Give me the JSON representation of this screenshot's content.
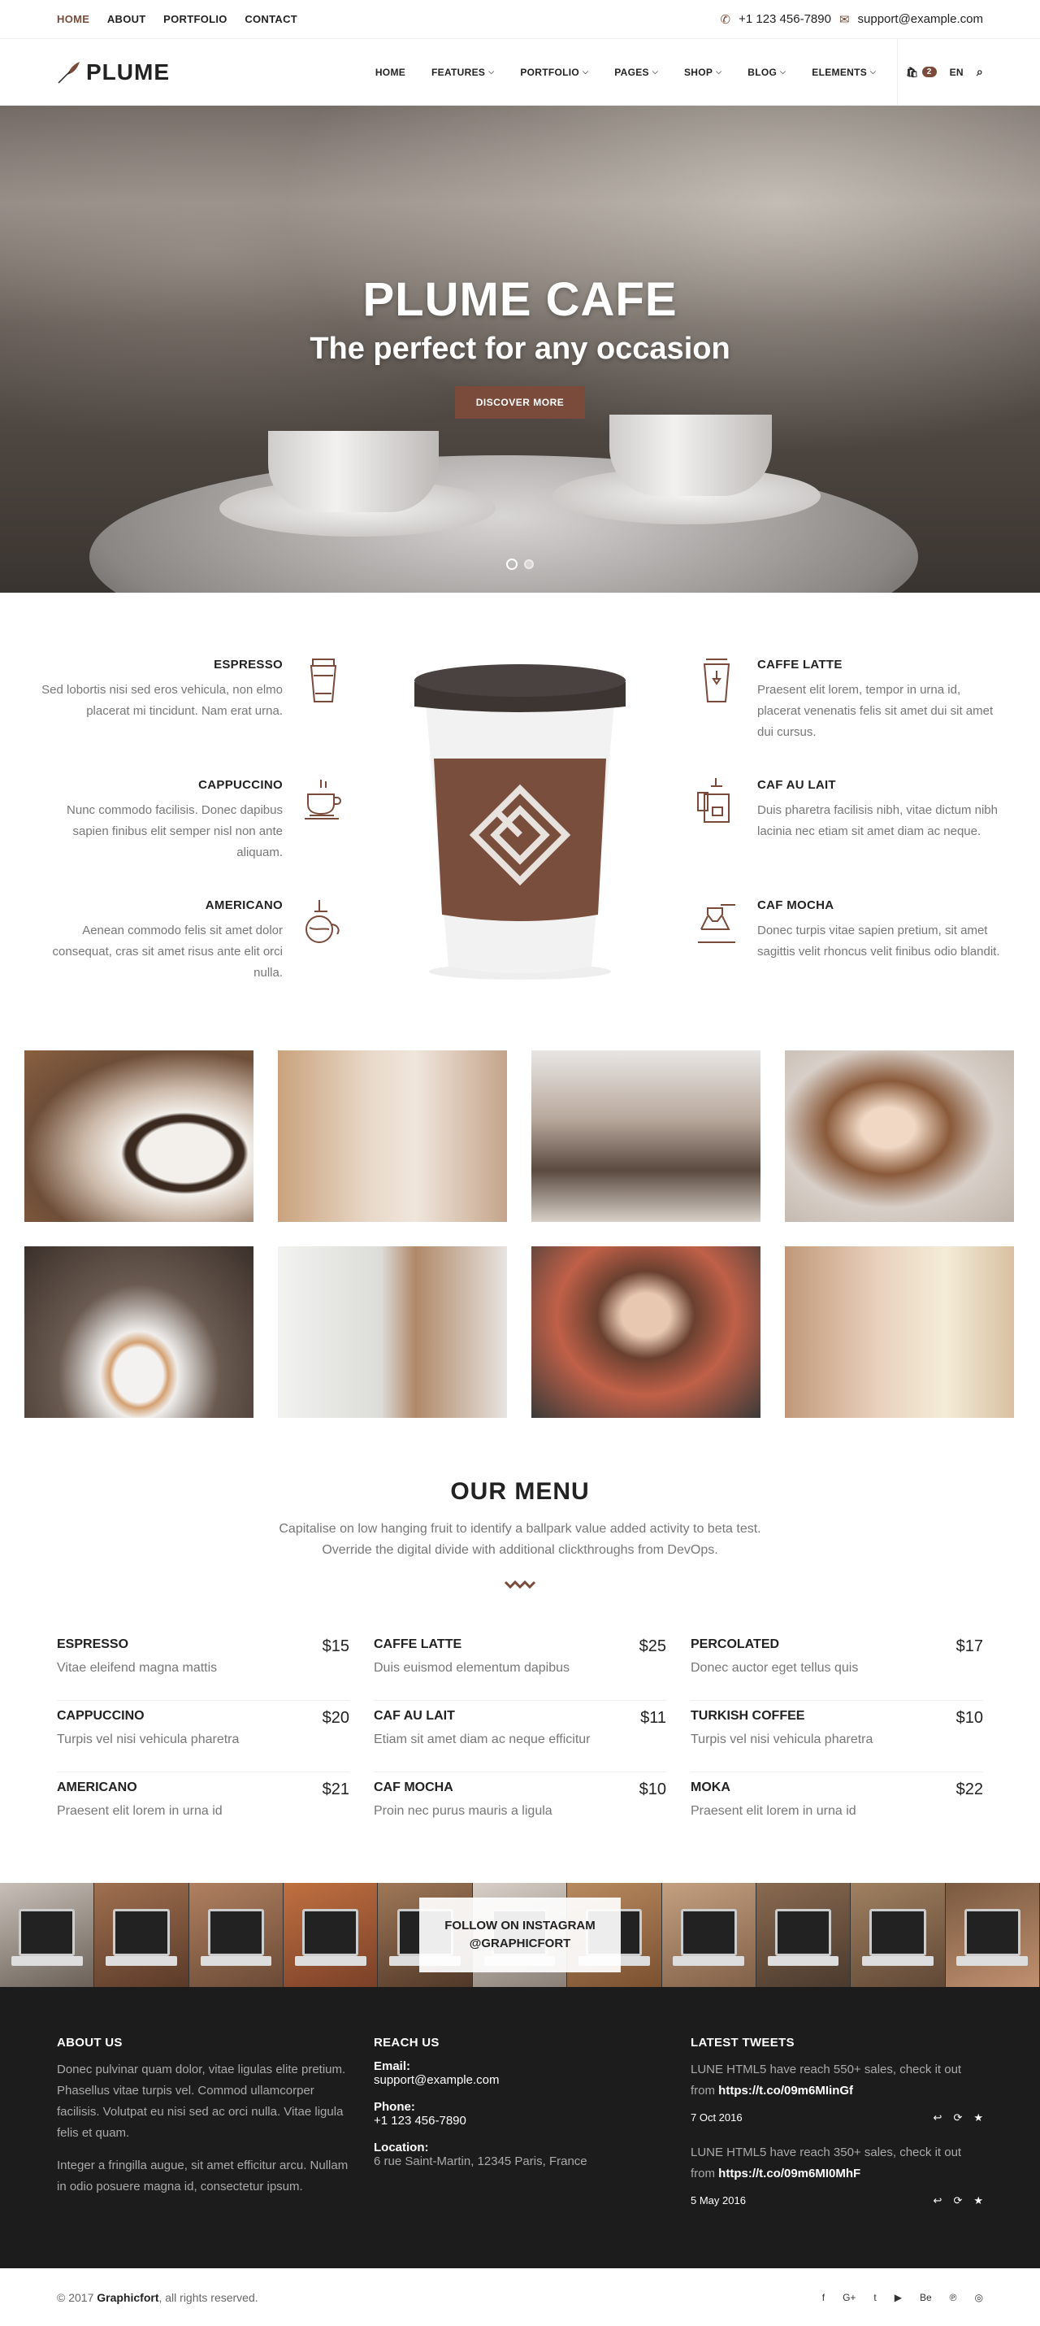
{
  "topbar": {
    "links": [
      "HOME",
      "ABOUT",
      "PORTFOLIO",
      "CONTACT"
    ],
    "phone": "+1 123 456-7890",
    "email": "support@example.com"
  },
  "header": {
    "logo": "PLUME",
    "nav": [
      "HOME",
      "FEATURES",
      "PORTFOLIO",
      "PAGES",
      "SHOP",
      "BLOG",
      "ELEMENTS"
    ],
    "cart_count": "2",
    "lang": "EN"
  },
  "hero": {
    "title": "PLUME CAFE",
    "subtitle": "The perfect for any occasion",
    "button": "DISCOVER MORE"
  },
  "features": {
    "left": [
      {
        "title": "ESPRESSO",
        "text": "Sed lobortis nisi sed eros vehicula, non elmo placerat mi tincidunt. Nam erat urna."
      },
      {
        "title": "CAPPUCCINO",
        "text": "Nunc commodo facilisis. Donec dapibus sapien finibus elit semper nisl non ante aliquam."
      },
      {
        "title": "AMERICANO",
        "text": "Aenean commodo felis sit amet dolor consequat, cras sit amet risus ante elit orci nulla."
      }
    ],
    "right": [
      {
        "title": "CAFFE LATTE",
        "text": "Praesent elit lorem, tempor in urna id, placerat venenatis felis sit amet dui sit amet dui cursus."
      },
      {
        "title": "CAF AU LAIT",
        "text": "Duis pharetra facilisis nibh, vitae dictum nibh lacinia nec etiam sit amet diam ac neque."
      },
      {
        "title": "CAF MOCHA",
        "text": "Donec turpis vitae sapien pretium, sit amet sagittis velit rhoncus velit finibus odio blandit."
      }
    ]
  },
  "menu": {
    "title": "OUR MENU",
    "line1": "Capitalise on low hanging fruit to identify a ballpark value added activity to beta test.",
    "line2": "Override the digital divide with additional clickthroughs from DevOps.",
    "items": [
      {
        "name": "ESPRESSO",
        "price": "$15",
        "desc": "Vitae eleifend magna mattis"
      },
      {
        "name": "CAFFE LATTE",
        "price": "$25",
        "desc": "Duis euismod elementum dapibus"
      },
      {
        "name": "PERCOLATED",
        "price": "$17",
        "desc": "Donec auctor eget tellus quis"
      },
      {
        "name": "CAPPUCCINO",
        "price": "$20",
        "desc": "Turpis vel nisi vehicula pharetra"
      },
      {
        "name": "CAF AU LAIT",
        "price": "$11",
        "desc": "Etiam sit amet diam ac neque efficitur"
      },
      {
        "name": "TURKISH COFFEE",
        "price": "$10",
        "desc": "Turpis vel nisi vehicula pharetra"
      },
      {
        "name": "AMERICANO",
        "price": "$21",
        "desc": "Praesent elit lorem in urna id"
      },
      {
        "name": "CAF MOCHA",
        "price": "$10",
        "desc": "Proin nec purus mauris a ligula"
      },
      {
        "name": "MOKA",
        "price": "$22",
        "desc": "Praesent elit lorem in urna id"
      }
    ]
  },
  "instagram": {
    "line1": "FOLLOW ON INSTAGRAM",
    "line2": "@GRAPHICFORT"
  },
  "footer": {
    "about_title": "ABOUT US",
    "about_p1": "Donec pulvinar quam dolor, vitae ligulas elite pretium. Phasellus vitae turpis vel. Commod ullamcorper facilisis. Volutpat eu nisi sed ac orci nulla. Vitae ligula felis et quam.",
    "about_p2": "Integer a fringilla augue, sit amet efficitur arcu. Nullam in odio posuere magna id, consectetur ipsum.",
    "reach_title": "REACH US",
    "email_label": "Email:",
    "email": "support@example.com",
    "phone_label": "Phone:",
    "phone": "+1 123 456-7890",
    "location_label": "Location:",
    "location": "6 rue Saint-Martin, 12345 Paris, France",
    "tweets_title": "LATEST TWEETS",
    "tweets": [
      {
        "text": "LUNE HTML5 have reach 550+ sales, check it out from ",
        "link": "https://t.co/09m6MIinGf",
        "date": "7 Oct 2016"
      },
      {
        "text": "LUNE HTML5 have reach 350+ sales, check it out from ",
        "link": "https://t.co/09m6MI0MhF",
        "date": "5 May 2016"
      }
    ]
  },
  "bottom": {
    "copy_pre": "© 2017 ",
    "copy_brand": "Graphicfort",
    "copy_post": ", all rights reserved.",
    "social": [
      "f",
      "G+",
      "t",
      "▶",
      "Be",
      "℗",
      "◎"
    ]
  },
  "colors": {
    "accent": "#7a4b3a",
    "footer_bg": "#1c1c1c"
  }
}
